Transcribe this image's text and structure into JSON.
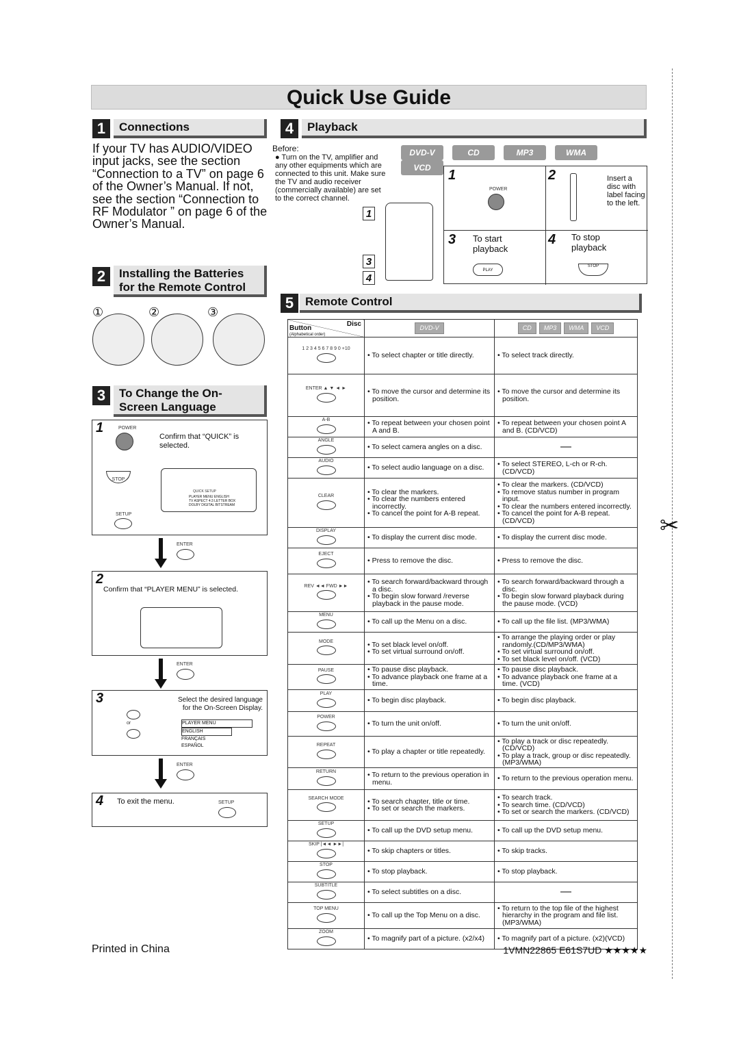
{
  "title": "Quick Use Guide",
  "sections": {
    "s1": {
      "num": "1",
      "title": "Connections",
      "text": "If your TV has AUDIO/VIDEO input jacks, see the section “Connection to a TV” on page 6 of the Owner’s Manual. If not, see the section “Connection to RF Modulator ” on page 6 of the Owner’s Manual."
    },
    "s2": {
      "num": "2",
      "title_line1": "Installing the Batteries",
      "title_line2": "for the Remote Control",
      "steps": [
        "①",
        "②",
        "③"
      ]
    },
    "s3": {
      "num": "3",
      "title_line1": "To Change the On-",
      "title_line2": "Screen Language",
      "step1": {
        "num": "1",
        "text": "Confirm that “QUICK” is selected.",
        "power": "POWER",
        "stop": "STOP",
        "setup": "SETUP",
        "menu_tab": "QUICK SETUP",
        "menu_rows": [
          [
            "PLAYER MENU",
            "ENGLISH"
          ],
          [
            "TV ASPECT",
            "4:3 LETTER BOX"
          ],
          [
            "DOLBY DIGITAL",
            "BITSTREAM"
          ]
        ]
      },
      "enter": "ENTER",
      "step2": {
        "num": "2",
        "text": "Confirm that “PLAYER MENU” is selected."
      },
      "step3": {
        "num": "3",
        "text_line1": "Select the desired language",
        "text_line2": "for the On-Screen Display.",
        "or": "or",
        "languages": [
          "PLAYER MENU",
          "ENGLISH",
          "FRANÇAIS",
          "ESPAÑOL"
        ]
      },
      "step4": {
        "num": "4",
        "text": "To exit the menu.",
        "setup": "SETUP"
      }
    },
    "s4": {
      "num": "4",
      "title": "Playback",
      "before": "Before:",
      "before_text": "Turn on the TV, amplifier and any other equipments which are connected to this unit. Make sure the TV and audio receiver (commercially available) are set to the correct channel.",
      "discs": [
        "DVD-V",
        "CD",
        "MP3",
        "WMA",
        "VCD"
      ],
      "steps": [
        {
          "num": "1",
          "label": "POWER"
        },
        {
          "num": "2",
          "text": "Insert a disc with label facing to the left."
        },
        {
          "num": "3",
          "text": "To start playback",
          "button": "PLAY"
        },
        {
          "num": "4",
          "text": "To stop playback",
          "button": "STOP"
        }
      ],
      "remote_markers": [
        "1",
        "3",
        "4"
      ]
    },
    "s5": {
      "num": "5",
      "title": "Remote Control",
      "header": {
        "disc": "Disc",
        "button": "Button",
        "order": "(Alphabetical order)",
        "dvd": "DVD-V",
        "others": [
          "CD",
          "MP3",
          "WMA",
          "VCD"
        ]
      },
      "rows": [
        {
          "button": "1 2 3 4 5 6 7 8 9 0 +10",
          "dvd": [
            "To select chapter or title directly."
          ],
          "cd": [
            "To select track directly."
          ]
        },
        {
          "button": "ENTER ▲ ▼ ◄ ►",
          "dvd": [
            "To move the cursor and determine its position."
          ],
          "cd": [
            "To move the cursor and determine its position."
          ]
        },
        {
          "button": "A-B",
          "dvd": [
            "To repeat between your chosen point A and B."
          ],
          "cd": [
            "To repeat between your chosen point A and B. (CD/VCD)"
          ]
        },
        {
          "button": "ANGLE",
          "dvd": [
            "To select camera angles on a disc."
          ],
          "cd": [],
          "cd_dash": "—"
        },
        {
          "button": "AUDIO",
          "dvd": [
            "To select audio language on a disc."
          ],
          "cd": [
            "To select STEREO, L-ch or R-ch. (CD/VCD)"
          ]
        },
        {
          "button": "CLEAR",
          "dvd": [
            "To clear the markers.",
            "To clear the numbers entered incorrectly.",
            "To cancel the point for A-B repeat."
          ],
          "cd": [
            "To clear the markers. (CD/VCD)",
            "To remove status number in program input.",
            "To clear the numbers entered incorrectly.",
            "To cancel the point for A-B repeat. (CD/VCD)"
          ]
        },
        {
          "button": "DISPLAY",
          "dvd": [
            "To display the current disc mode."
          ],
          "cd": [
            "To display the current disc mode."
          ]
        },
        {
          "button": "EJECT",
          "dvd": [
            "Press to remove the disc."
          ],
          "cd": [
            "Press to remove the disc."
          ]
        },
        {
          "button": "REV ◄◄   FWD ►►",
          "dvd": [
            "To search forward/backward through a disc.",
            "To begin slow forward /reverse playback in the pause mode."
          ],
          "cd": [
            "To search forward/backward through a disc.",
            "To begin slow forward playback during the pause mode. (VCD)"
          ]
        },
        {
          "button": "MENU",
          "dvd": [
            "To call up the Menu on a disc."
          ],
          "cd": [
            "To call up the file list. (MP3/WMA)"
          ]
        },
        {
          "button": "MODE",
          "dvd": [
            "To set black level on/off.",
            "To set virtual surround on/off."
          ],
          "cd": [
            "To arrange the playing order or play randomly.(CD/MP3/WMA)",
            "To set virtual surround on/off.",
            "To set black level on/off. (VCD)"
          ]
        },
        {
          "button": "PAUSE",
          "dvd": [
            "To pause disc playback.",
            "To advance playback one frame at a time."
          ],
          "cd": [
            "To pause disc playback.",
            "To advance playback one frame at a time. (VCD)"
          ]
        },
        {
          "button": "PLAY",
          "dvd": [
            "To begin disc playback."
          ],
          "cd": [
            "To begin disc playback."
          ]
        },
        {
          "button": "POWER",
          "dvd": [
            "To turn the unit on/off."
          ],
          "cd": [
            "To turn the unit on/off."
          ]
        },
        {
          "button": "REPEAT",
          "dvd": [
            "To play a chapter or title repeatedly."
          ],
          "cd": [
            "To play a track or disc repeatedly. (CD/VCD)",
            "To play a track, group or disc repeatedly. (MP3/WMA)"
          ]
        },
        {
          "button": "RETURN",
          "dvd": [
            "To return to the previous operation in menu."
          ],
          "cd": [
            "To return to the previous operation menu."
          ]
        },
        {
          "button": "SEARCH MODE",
          "dvd": [
            "To search chapter, title or time.",
            "To set or search the markers."
          ],
          "cd": [
            "To search track.",
            "To search time. (CD/VCD)",
            "To set or search the markers. (CD/VCD)"
          ]
        },
        {
          "button": "SETUP",
          "dvd": [
            "To call up the DVD setup menu."
          ],
          "cd": [
            "To call up the DVD setup menu."
          ]
        },
        {
          "button": "SKIP |◄◄ ►►|",
          "dvd": [
            "To skip chapters or titles."
          ],
          "cd": [
            "To skip tracks."
          ]
        },
        {
          "button": "STOP",
          "dvd": [
            "To stop playback."
          ],
          "cd": [
            "To stop playback."
          ]
        },
        {
          "button": "SUBTITLE",
          "dvd": [
            "To select subtitles on a disc."
          ],
          "cd": [],
          "cd_dash": "—"
        },
        {
          "button": "TOP MENU",
          "dvd": [
            "To call up the Top Menu on a disc."
          ],
          "cd": [
            "To return to the top file of the highest hierarchy in the program and file list. (MP3/WMA)"
          ]
        },
        {
          "button": "ZOOM",
          "dvd": [
            "To magnify part of a picture. (x2/x4)"
          ],
          "cd": [
            "To magnify part of a picture. (x2)(VCD)"
          ]
        }
      ]
    }
  },
  "footer": {
    "left": "Printed in China",
    "right": "1VMN22865 E61S7UD ★★★★★"
  },
  "icons": {
    "cut": "scissors-icon"
  }
}
